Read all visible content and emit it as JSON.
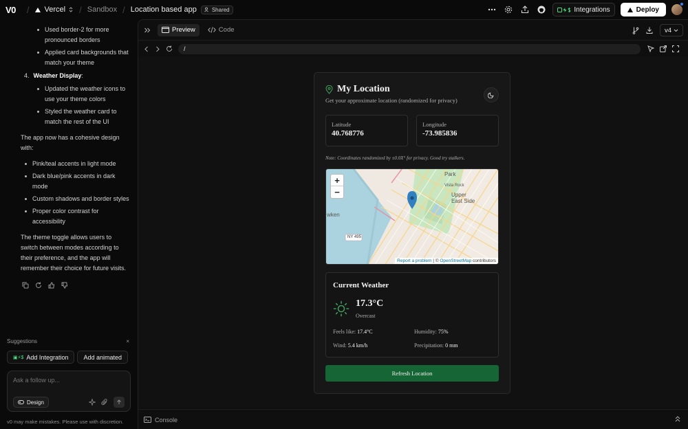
{
  "topbar": {
    "logo": "V0",
    "team": "Vercel",
    "folder": "Sandbox",
    "project": "Location based app",
    "shared_label": "Shared",
    "integrations_label": "Integrations",
    "deploy_label": "Deploy"
  },
  "chat": {
    "bullets_top": [
      "Used border-2 for more pronounced borders",
      "Applied card backgrounds that match your theme"
    ],
    "numbered": {
      "num": "4.",
      "title": "Weather Display",
      "suffix": ":"
    },
    "bullets_weather": [
      "Updated the weather icons to use your theme colors",
      "Styled the weather card to match the rest of the UI"
    ],
    "para1": "The app now has a cohesive design with:",
    "design_points": [
      "Pink/teal accents in light mode",
      "Dark blue/pink accents in dark mode",
      "Custom shadows and border styles",
      "Proper color contrast for accessibility"
    ],
    "para2": "The theme toggle allows users to switch between modes according to their preference, and the app will remember their choice for future visits."
  },
  "suggestions": {
    "heading": "Suggestions",
    "items": [
      "Add Integration",
      "Add animated"
    ]
  },
  "composer": {
    "placeholder": "Ask a follow up...",
    "design_label": "Design"
  },
  "disclaimer": "v0 may make mistakes. Please use with discretion.",
  "preview": {
    "tab_preview": "Preview",
    "tab_code": "Code",
    "version": "v4",
    "url": "/",
    "console_label": "Console"
  },
  "app": {
    "title": "My Location",
    "subtitle": "Get your approximate location (randomized for privacy)",
    "latitude_label": "Latitude",
    "latitude_value": "40.768776",
    "longitude_label": "Longitude",
    "longitude_value": "-73.985836",
    "note": "Note: Coordinates randomized by ±0.0X° for privacy. Good try stalkers.",
    "map": {
      "zoom_in": "+",
      "zoom_out": "−",
      "labels": [
        "Park",
        "Upper East Side",
        "Vista Rock",
        "wken",
        "NY 495"
      ],
      "attribution_report": "Report a problem",
      "attribution_sep": "| ©",
      "attribution_osm": "OpenStreetMap",
      "attribution_contrib": "contributors"
    },
    "weather": {
      "title": "Current Weather",
      "temp": "17.3°C",
      "condition": "Overcast",
      "feels_label": "Feels like:",
      "feels_value": "17.4°C",
      "humidity_label": "Humidity:",
      "humidity_value": "75%",
      "wind_label": "Wind:",
      "wind_value": "5.4 km/h",
      "precip_label": "Precipitation:",
      "precip_value": "0 mm"
    },
    "refresh_label": "Refresh Location"
  },
  "colors": {
    "accent_green": "#166534",
    "pin_blue": "#2f7fc1",
    "sun_green": "#3f9a5a",
    "background": "#0a0a0a"
  }
}
